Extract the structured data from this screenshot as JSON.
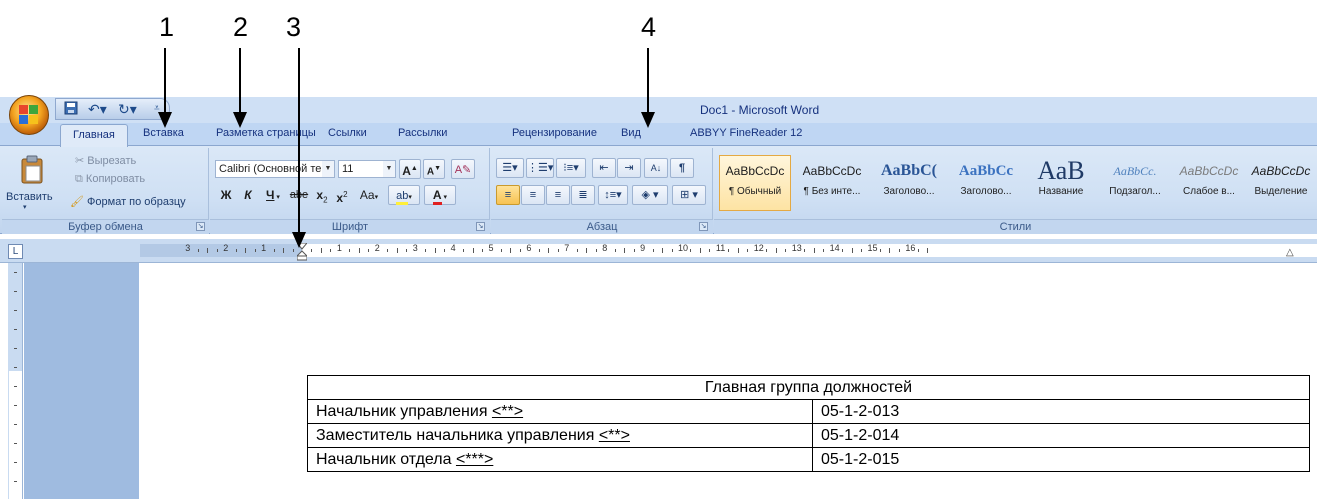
{
  "annotations": [
    "1",
    "2",
    "3",
    "4"
  ],
  "window": {
    "title": "Doc1 - Microsoft Word"
  },
  "quick_access": {
    "icons": [
      "save-icon",
      "undo-icon",
      "redo-icon",
      "customize-icon"
    ]
  },
  "tabs": [
    {
      "label": "Главная",
      "active": true
    },
    {
      "label": "Вставка"
    },
    {
      "label": "Разметка страницы"
    },
    {
      "label": "Ссылки"
    },
    {
      "label": "Рассылки"
    },
    {
      "label": "Рецензирование"
    },
    {
      "label": "Вид"
    },
    {
      "label": "ABBYY FineReader 12"
    }
  ],
  "ribbon": {
    "clipboard": {
      "paste": "Вставить",
      "cut": "Вырезать",
      "copy": "Копировать",
      "format_painter": "Формат по образцу",
      "label": "Буфер обмена"
    },
    "font": {
      "font_name": "Calibri (Основной те",
      "font_size": "11",
      "grow": "A",
      "shrink": "A",
      "bold": "Ж",
      "italic": "К",
      "underline": "Ч",
      "strike": "abe",
      "subscript": "x",
      "superscript": "x",
      "change_case": "Aa",
      "font_color": "A",
      "label": "Шрифт"
    },
    "paragraph": {
      "label": "Абзац",
      "show_marks": "¶",
      "sort": "А↓"
    },
    "styles": {
      "label": "Стили",
      "items": [
        {
          "sample": "AaBbCcDc",
          "name": "¶ Обычный",
          "selected": true
        },
        {
          "sample": "AaBbCcDc",
          "name": "¶ Без инте..."
        },
        {
          "sample": "AaBbC(",
          "name": "Заголово..."
        },
        {
          "sample": "AaBbCc",
          "name": "Заголово..."
        },
        {
          "sample": "АаВ",
          "name": "Название"
        },
        {
          "sample": "AaBbCc.",
          "name": "Подзагол..."
        },
        {
          "sample": "AaBbCcDc",
          "name": "Слабое в..."
        },
        {
          "sample": "AaBbCcDc",
          "name": "Выделение"
        }
      ]
    }
  },
  "ruler": {
    "left_numbers": [
      "3",
      "2",
      "1"
    ],
    "right_numbers": [
      "1",
      "2",
      "3",
      "4",
      "5",
      "6",
      "7",
      "8",
      "9",
      "10",
      "11",
      "12",
      "13",
      "14",
      "15",
      "16"
    ]
  },
  "document": {
    "table": {
      "header": "Главная группа должностей",
      "rows": [
        {
          "name": "Начальник управления ",
          "ref": "<**>",
          "code": "05-1-2-013"
        },
        {
          "name": "Заместитель начальника управления ",
          "ref": "<**>",
          "code": "05-1-2-014"
        },
        {
          "name": "Начальник отдела ",
          "ref": "<***>",
          "code": "05-1-2-015"
        }
      ]
    }
  }
}
